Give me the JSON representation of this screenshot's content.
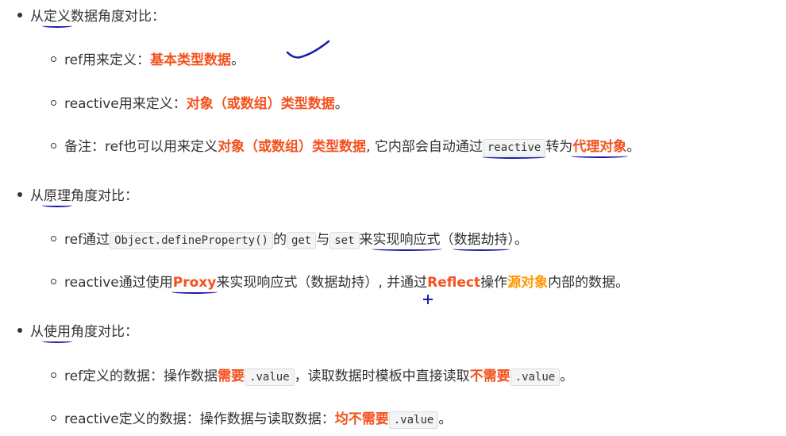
{
  "sections": [
    {
      "heading": {
        "pre": "从",
        "u": "定义",
        "post": "数据角度对比："
      },
      "items": [
        {
          "t1": "ref用来定义：",
          "h1": "基本类型数据",
          "t2": "。"
        },
        {
          "t1": "reactive用来定义：",
          "h1": "对象（或数组）类型数据",
          "t2": "。"
        },
        {
          "t1": "备注：ref也可以用来定义",
          "h1": "对象（或数组）类型数据",
          "t2": ", 它内部会自动通过",
          "code": "reactive",
          "t3": "转为",
          "h2": "代理对象",
          "t4": "。"
        }
      ]
    },
    {
      "heading": {
        "pre": "从",
        "u": "原理",
        "post": "角度对比："
      },
      "items": [
        {
          "t1": "ref通过",
          "code1": "Object.defineProperty()",
          "t2": "的",
          "code2": "get",
          "t3": "与",
          "code3": "set",
          "t4": "来",
          "u1": "实现响应式",
          "t5": "（",
          "u2": "数据劫持",
          "t6": "）。"
        },
        {
          "t1": "reactive通过使用",
          "h1": "Proxy",
          "t2": "来实现响应式（数据劫持）, 并通过",
          "h2": "Reflect",
          "t3": "操作",
          "h3": "源对象",
          "t4": "内部的数据。"
        }
      ]
    },
    {
      "heading": {
        "pre": "从",
        "u": "使用",
        "post": "角度对比："
      },
      "items": [
        {
          "t1": "ref定义的数据：操作数据",
          "h1": "需要",
          "code1": ".value",
          "t2": "，读取数据时模板中直接读取",
          "h2": "不需要",
          "code2": ".value",
          "t3": "。"
        },
        {
          "t1": "reactive定义的数据：操作数据与读取数据：",
          "h1": "均不需要",
          "code1": ".value",
          "t2": "。"
        }
      ]
    }
  ],
  "colors": {
    "highlight_red": "#f4511e",
    "highlight_orange": "#ff9800",
    "pen": "#1a1aa8"
  }
}
